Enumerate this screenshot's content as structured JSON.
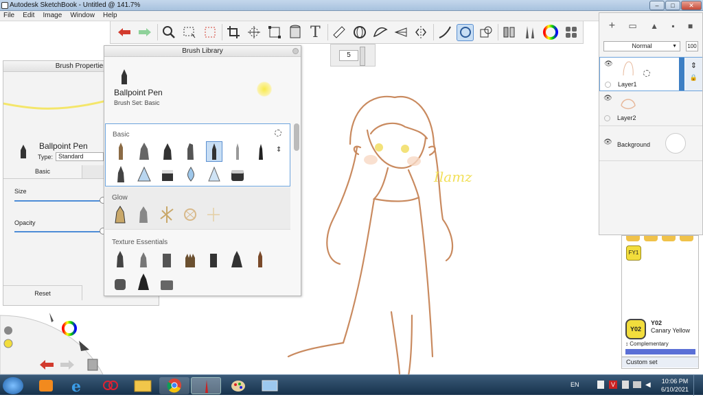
{
  "window": {
    "title": "Autodesk SketchBook - Untitled @ 141.7%"
  },
  "menu": [
    "File",
    "Edit",
    "Image",
    "Window",
    "Help"
  ],
  "toolbar": {
    "icons": [
      "undo-icon",
      "redo-icon",
      "zoom-icon",
      "select-icon",
      "transform-icon",
      "crop-icon",
      "distort-icon",
      "perspective-icon",
      "bucket-icon",
      "text-icon",
      "ruler-icon",
      "ellipse-guide-icon",
      "french-curve-icon",
      "perspective-guide-icon",
      "symmetry-icon",
      "stroke-icon",
      "predictive-stroke-icon",
      "shape-icon",
      "copic-icon",
      "brush-palette-icon",
      "color-wheel-icon",
      "layers-icon"
    ],
    "brush_size": "5"
  },
  "brush_properties": {
    "title": "Brush Properties",
    "brush_name": "Ballpoint Pen",
    "type_label": "Type:",
    "type_value": "Standard",
    "tab_basic": "Basic",
    "size_label": "Size",
    "opacity_label": "Opacity",
    "reset_label": "Reset"
  },
  "brush_library": {
    "title": "Brush Library",
    "brush_name": "Ballpoint Pen",
    "brush_set": "Brush Set: Basic",
    "sections": [
      {
        "name": "Basic",
        "count": 13
      },
      {
        "name": "Glow",
        "count": 5
      },
      {
        "name": "Texture Essentials",
        "count": 10
      }
    ]
  },
  "layers": {
    "blend_mode": "Normal",
    "opacity": "100",
    "items": [
      {
        "name": "Layer1",
        "selected": true
      },
      {
        "name": "Layer2",
        "selected": false
      },
      {
        "name": "Background",
        "selected": false
      }
    ]
  },
  "color": {
    "swatch_label": "FY1",
    "code": "Y02",
    "name": "Canary Yellow",
    "complementary": "Complementary",
    "custom_set": "Custom set",
    "current_color": "#f2dd3c"
  },
  "canvas": {
    "signature": "Ilamz",
    "stroke_color": "#c98a5f"
  },
  "taskbar": {
    "lang": "EN",
    "time": "10:06 PM",
    "date": "6/10/2021"
  },
  "accent": "#3d7fc4"
}
